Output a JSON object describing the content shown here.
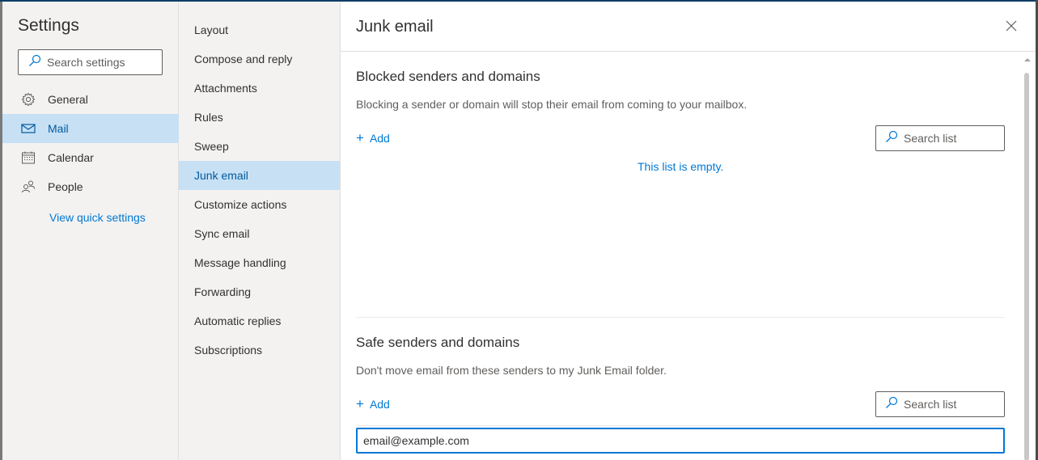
{
  "nav": {
    "title": "Settings",
    "search_placeholder": "Search settings",
    "items": [
      {
        "label": "General",
        "icon": "gear-icon"
      },
      {
        "label": "Mail",
        "icon": "mail-icon",
        "selected": true
      },
      {
        "label": "Calendar",
        "icon": "calendar-icon"
      },
      {
        "label": "People",
        "icon": "people-icon"
      }
    ],
    "quick_settings_link": "View quick settings"
  },
  "subnav": {
    "items": [
      {
        "label": "Layout"
      },
      {
        "label": "Compose and reply"
      },
      {
        "label": "Attachments"
      },
      {
        "label": "Rules"
      },
      {
        "label": "Sweep"
      },
      {
        "label": "Junk email",
        "selected": true
      },
      {
        "label": "Customize actions"
      },
      {
        "label": "Sync email"
      },
      {
        "label": "Message handling"
      },
      {
        "label": "Forwarding"
      },
      {
        "label": "Automatic replies"
      },
      {
        "label": "Subscriptions"
      }
    ]
  },
  "main": {
    "title": "Junk email",
    "blocked": {
      "title": "Blocked senders and domains",
      "description": "Blocking a sender or domain will stop their email from coming to your mailbox.",
      "add_label": "Add",
      "search_placeholder": "Search list",
      "empty_message": "This list is empty."
    },
    "safe": {
      "title": "Safe senders and domains",
      "description": "Don't move email from these senders to my Junk Email folder.",
      "add_label": "Add",
      "search_placeholder": "Search list",
      "input_value": "email@example.com"
    }
  },
  "colors": {
    "accent": "#0078d4",
    "selected_bg": "#c7e0f4",
    "nav_bg": "#f3f2f1"
  }
}
